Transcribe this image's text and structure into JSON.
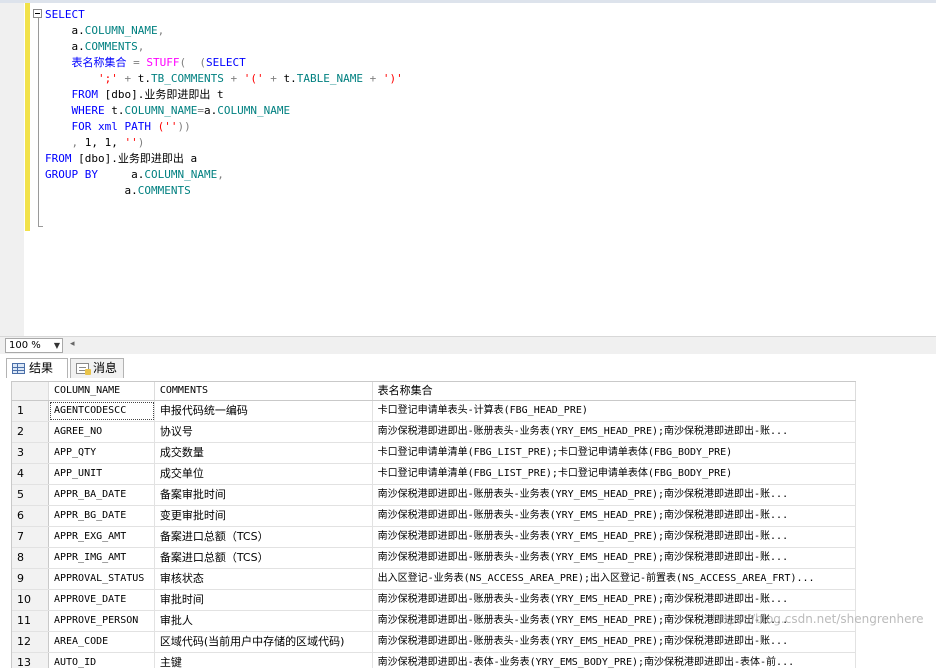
{
  "editor": {
    "lines": [
      [
        {
          "t": "SELECT",
          "c": "kw"
        }
      ],
      [
        {
          "t": "    a.",
          "c": ""
        },
        {
          "t": "COLUMN_NAME",
          "c": "co"
        },
        {
          "t": ",",
          "c": "gr"
        }
      ],
      [
        {
          "t": "    a.",
          "c": ""
        },
        {
          "t": "COMMENTS",
          "c": "co"
        },
        {
          "t": ",",
          "c": "gr"
        }
      ],
      [
        {
          "t": "    表名称集合 ",
          "c": "kw"
        },
        {
          "t": "= ",
          "c": "gr"
        },
        {
          "t": "STUFF",
          "c": "fn"
        },
        {
          "t": "( ",
          "c": "gr"
        },
        {
          "t": " (",
          "c": "gr"
        },
        {
          "t": "SELECT",
          "c": "kw"
        }
      ],
      [
        {
          "t": "        ';' ",
          "c": "st"
        },
        {
          "t": "+ ",
          "c": "gr"
        },
        {
          "t": "t.",
          "c": ""
        },
        {
          "t": "TB_COMMENTS",
          "c": "co"
        },
        {
          "t": " + ",
          "c": "gr"
        },
        {
          "t": "'(' ",
          "c": "st"
        },
        {
          "t": "+ ",
          "c": "gr"
        },
        {
          "t": "t.",
          "c": ""
        },
        {
          "t": "TABLE_NAME",
          "c": "co"
        },
        {
          "t": " + ",
          "c": "gr"
        },
        {
          "t": "')'",
          "c": "st"
        }
      ],
      [
        {
          "t": "    FROM ",
          "c": "kw"
        },
        {
          "t": "[dbo].",
          "c": ""
        },
        {
          "t": "业务即进即出 t",
          "c": ""
        }
      ],
      [
        {
          "t": "    WHERE ",
          "c": "kw"
        },
        {
          "t": "t.",
          "c": ""
        },
        {
          "t": "COLUMN_NAME",
          "c": "co"
        },
        {
          "t": "=",
          "c": "gr"
        },
        {
          "t": "a.",
          "c": ""
        },
        {
          "t": "COLUMN_NAME",
          "c": "co"
        }
      ],
      [
        {
          "t": "    FOR ",
          "c": "kw"
        },
        {
          "t": "xml ",
          "c": "kw"
        },
        {
          "t": "PATH ",
          "c": "kw"
        },
        {
          "t": "(''",
          "c": "st"
        },
        {
          "t": "))",
          "c": "gr"
        }
      ],
      [
        {
          "t": "    , ",
          "c": "gr"
        },
        {
          "t": "1, 1, ",
          "c": ""
        },
        {
          "t": "''",
          "c": "st"
        },
        {
          "t": ")",
          "c": "gr"
        }
      ],
      [
        {
          "t": "FROM ",
          "c": "kw"
        },
        {
          "t": "[dbo].",
          "c": ""
        },
        {
          "t": "业务即进即出 a",
          "c": ""
        }
      ],
      [
        {
          "t": "GROUP BY ",
          "c": "kw"
        },
        {
          "t": "    a.",
          "c": ""
        },
        {
          "t": "COLUMN_NAME",
          "c": "co"
        },
        {
          "t": ",",
          "c": "gr"
        }
      ],
      [
        {
          "t": "            a.",
          "c": ""
        },
        {
          "t": "COMMENTS",
          "c": "co"
        }
      ]
    ]
  },
  "zoom": {
    "value": "100 %"
  },
  "tabs": [
    {
      "label": "结果",
      "icon": "grid-icon"
    },
    {
      "label": "消息",
      "icon": "messages-icon"
    }
  ],
  "results": {
    "columns": [
      "COLUMN_NAME",
      "COMMENTS",
      "表名称集合"
    ],
    "rows": [
      {
        "idx": "1",
        "col": "AGENTCODESCC",
        "com": "申报代码统一编码",
        "tab": "卡口登记申请单表头-计算表(FBG_HEAD_PRE)"
      },
      {
        "idx": "2",
        "col": "AGREE_NO",
        "com": "协议号",
        "tab": "南沙保税港即进即出-账册表头-业务表(YRY_EMS_HEAD_PRE);南沙保税港即进即出-账..."
      },
      {
        "idx": "3",
        "col": "APP_QTY",
        "com": "成交数量",
        "tab": "卡口登记申请单清单(FBG_LIST_PRE);卡口登记申请单表体(FBG_BODY_PRE)"
      },
      {
        "idx": "4",
        "col": "APP_UNIT",
        "com": "成交单位",
        "tab": "卡口登记申请单清单(FBG_LIST_PRE);卡口登记申请单表体(FBG_BODY_PRE)"
      },
      {
        "idx": "5",
        "col": "APPR_BA_DATE",
        "com": "备案审批时间",
        "tab": "南沙保税港即进即出-账册表头-业务表(YRY_EMS_HEAD_PRE);南沙保税港即进即出-账..."
      },
      {
        "idx": "6",
        "col": "APPR_BG_DATE",
        "com": "变更审批时间",
        "tab": "南沙保税港即进即出-账册表头-业务表(YRY_EMS_HEAD_PRE);南沙保税港即进即出-账..."
      },
      {
        "idx": "7",
        "col": "APPR_EXG_AMT",
        "com": "备案进口总额（TCS）",
        "tab": "南沙保税港即进即出-账册表头-业务表(YRY_EMS_HEAD_PRE);南沙保税港即进即出-账..."
      },
      {
        "idx": "8",
        "col": "APPR_IMG_AMT",
        "com": "备案进口总额（TCS）",
        "tab": "南沙保税港即进即出-账册表头-业务表(YRY_EMS_HEAD_PRE);南沙保税港即进即出-账..."
      },
      {
        "idx": "9",
        "col": "APPROVAL_STATUS",
        "com": "审核状态",
        "tab": "出入区登记-业务表(NS_ACCESS_AREA_PRE);出入区登记-前置表(NS_ACCESS_AREA_FRT)..."
      },
      {
        "idx": "10",
        "col": "APPROVE_DATE",
        "com": "审批时间",
        "tab": "南沙保税港即进即出-账册表头-业务表(YRY_EMS_HEAD_PRE);南沙保税港即进即出-账..."
      },
      {
        "idx": "11",
        "col": "APPROVE_PERSON",
        "com": "审批人",
        "tab": "南沙保税港即进即出-账册表头-业务表(YRY_EMS_HEAD_PRE);南沙保税港即进即出-账..."
      },
      {
        "idx": "12",
        "col": "AREA_CODE",
        "com": "区域代码(当前用户中存储的区域代码)",
        "tab": "南沙保税港即进即出-账册表头-业务表(YRY_EMS_HEAD_PRE);南沙保税港即进即出-账..."
      },
      {
        "idx": "13",
        "col": "AUTO_ID",
        "com": "主键",
        "tab": "南沙保税港即进即出-表体-业务表(YRY_EMS_BODY_PRE);南沙保税港即进即出-表体-前..."
      }
    ]
  },
  "watermark": "https://blog.csdn.net/shengrenhere"
}
